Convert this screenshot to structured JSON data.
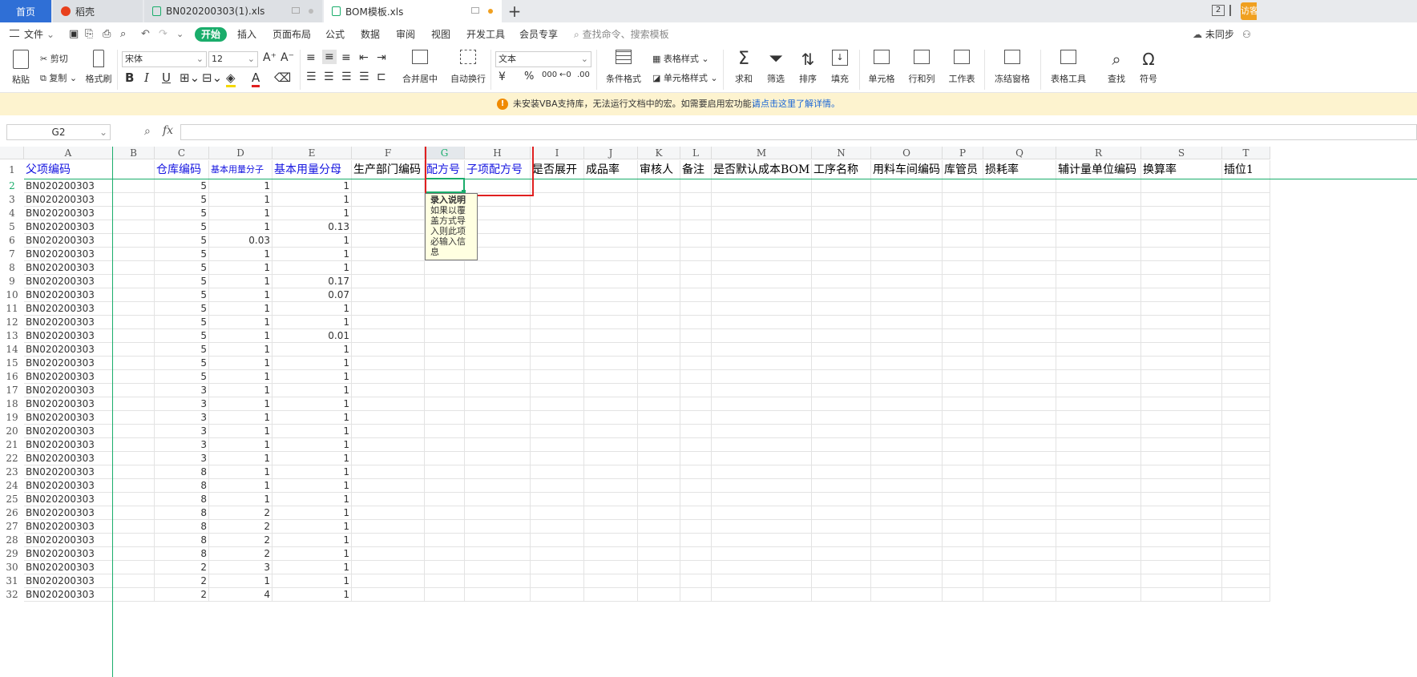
{
  "tabs": [
    {
      "label": "首页"
    },
    {
      "label": "稻壳"
    },
    {
      "label": "BN020200303(1).xls"
    },
    {
      "label": "BOM模板.xls"
    }
  ],
  "tabbar_right": {
    "badge": "2",
    "visitor": "访客"
  },
  "menu": {
    "file": "文件",
    "items": [
      "开始",
      "插入",
      "页面布局",
      "公式",
      "数据",
      "审阅",
      "视图",
      "开发工具",
      "会员专享"
    ],
    "search_placeholder": "查找命令、搜索模板",
    "sync": "未同步"
  },
  "ribbon": {
    "paste": "粘贴",
    "cut": "剪切",
    "copy": "复制",
    "format_painter": "格式刷",
    "font_name": "宋体",
    "font_size": "12",
    "merge_center": "合并居中",
    "wrap": "自动换行",
    "number_format": "文本",
    "currency": "¥",
    "percent": "%",
    "thousands": "000",
    "cond_format": "条件格式",
    "table_style": "表格样式",
    "cell_style": "单元格样式",
    "sum": "求和",
    "filter": "筛选",
    "sort": "排序",
    "fill": "填充",
    "cells": "单元格",
    "rows_cols": "行和列",
    "worksheet": "工作表",
    "freeze": "冻结窗格",
    "table_tools": "表格工具",
    "find": "查找",
    "symbol": "符号",
    "bold": "B",
    "italic": "I",
    "underline": "U"
  },
  "notice": {
    "text": "未安装VBA支持库，无法运行文档中的宏。如需要启用宏功能，",
    "link": "请点击这里了解详情。"
  },
  "formula": {
    "cell_ref": "G2",
    "fx": "fx",
    "value": ""
  },
  "columns": [
    "A",
    "B",
    "C",
    "D",
    "E",
    "F",
    "G",
    "H",
    "I",
    "J",
    "K",
    "L",
    "M",
    "N",
    "O",
    "P",
    "Q",
    "R",
    "S",
    "T"
  ],
  "headers": {
    "A": "父项编码",
    "C": "仓库编码",
    "D": "基本用量分子",
    "E": "基本用量分母",
    "F": "生产部门编码",
    "G": "配方号",
    "H": "子项配方号",
    "I": "是否展开",
    "J": "成品率",
    "K": "审核人",
    "L": "备注",
    "M": "是否默认成本BOM",
    "N": "工序名称",
    "O": "用料车间编码",
    "P": "库管员",
    "Q": "损耗率",
    "R": "辅计量单位编码",
    "S": "换算率",
    "T": "插位1"
  },
  "rows": [
    {
      "n": "2",
      "A": "BN020200303",
      "C": "5",
      "D": "1",
      "E": "1"
    },
    {
      "n": "3",
      "A": "BN020200303",
      "C": "5",
      "D": "1",
      "E": "1"
    },
    {
      "n": "4",
      "A": "BN020200303",
      "C": "5",
      "D": "1",
      "E": "1"
    },
    {
      "n": "5",
      "A": "BN020200303",
      "C": "5",
      "D": "1",
      "E": "0.13"
    },
    {
      "n": "6",
      "A": "BN020200303",
      "C": "5",
      "D": "0.03",
      "E": "1"
    },
    {
      "n": "7",
      "A": "BN020200303",
      "C": "5",
      "D": "1",
      "E": "1"
    },
    {
      "n": "8",
      "A": "BN020200303",
      "C": "5",
      "D": "1",
      "E": "1"
    },
    {
      "n": "9",
      "A": "BN020200303",
      "C": "5",
      "D": "1",
      "E": "0.17"
    },
    {
      "n": "10",
      "A": "BN020200303",
      "C": "5",
      "D": "1",
      "E": "0.07"
    },
    {
      "n": "11",
      "A": "BN020200303",
      "C": "5",
      "D": "1",
      "E": "1"
    },
    {
      "n": "12",
      "A": "BN020200303",
      "C": "5",
      "D": "1",
      "E": "1"
    },
    {
      "n": "13",
      "A": "BN020200303",
      "C": "5",
      "D": "1",
      "E": "0.01"
    },
    {
      "n": "14",
      "A": "BN020200303",
      "C": "5",
      "D": "1",
      "E": "1"
    },
    {
      "n": "15",
      "A": "BN020200303",
      "C": "5",
      "D": "1",
      "E": "1"
    },
    {
      "n": "16",
      "A": "BN020200303",
      "C": "5",
      "D": "1",
      "E": "1"
    },
    {
      "n": "17",
      "A": "BN020200303",
      "C": "3",
      "D": "1",
      "E": "1"
    },
    {
      "n": "18",
      "A": "BN020200303",
      "C": "3",
      "D": "1",
      "E": "1"
    },
    {
      "n": "19",
      "A": "BN020200303",
      "C": "3",
      "D": "1",
      "E": "1"
    },
    {
      "n": "20",
      "A": "BN020200303",
      "C": "3",
      "D": "1",
      "E": "1"
    },
    {
      "n": "21",
      "A": "BN020200303",
      "C": "3",
      "D": "1",
      "E": "1"
    },
    {
      "n": "22",
      "A": "BN020200303",
      "C": "3",
      "D": "1",
      "E": "1"
    },
    {
      "n": "23",
      "A": "BN020200303",
      "C": "8",
      "D": "1",
      "E": "1"
    },
    {
      "n": "24",
      "A": "BN020200303",
      "C": "8",
      "D": "1",
      "E": "1"
    },
    {
      "n": "25",
      "A": "BN020200303",
      "C": "8",
      "D": "1",
      "E": "1"
    },
    {
      "n": "26",
      "A": "BN020200303",
      "C": "8",
      "D": "2",
      "E": "1"
    },
    {
      "n": "27",
      "A": "BN020200303",
      "C": "8",
      "D": "2",
      "E": "1"
    },
    {
      "n": "28",
      "A": "BN020200303",
      "C": "8",
      "D": "2",
      "E": "1"
    },
    {
      "n": "29",
      "A": "BN020200303",
      "C": "8",
      "D": "2",
      "E": "1"
    },
    {
      "n": "30",
      "A": "BN020200303",
      "C": "2",
      "D": "3",
      "E": "1"
    },
    {
      "n": "31",
      "A": "BN020200303",
      "C": "2",
      "D": "1",
      "E": "1"
    },
    {
      "n": "32",
      "A": "BN020200303",
      "C": "2",
      "D": "4",
      "E": "1"
    }
  ],
  "header_row_num": "1",
  "tooltip": {
    "title": "录入说明",
    "lines": [
      "如果以覆",
      "盖方式导",
      "入则此项",
      "必输入信",
      "息"
    ]
  },
  "colors": {
    "accent": "#1aad6b",
    "highlight_box": "#e02020",
    "blue_header": "#1515e0"
  }
}
